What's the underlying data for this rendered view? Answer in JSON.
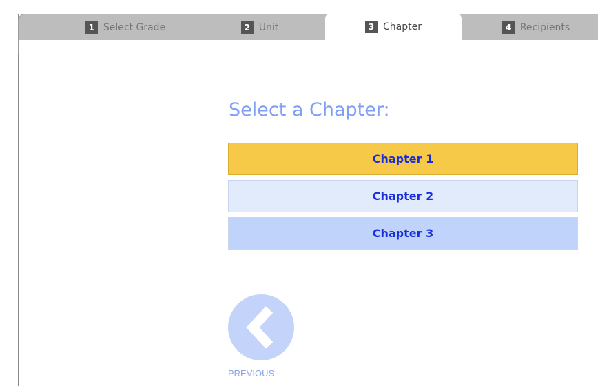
{
  "tabs": [
    {
      "num": "1",
      "label": "Select Grade"
    },
    {
      "num": "2",
      "label": "Unit"
    },
    {
      "num": "3",
      "label": "Chapter"
    },
    {
      "num": "4",
      "label": "Recipients"
    }
  ],
  "active_tab": "3",
  "heading": "Select a Chapter:",
  "chapters": [
    {
      "label": "Chapter 1",
      "state": "selected"
    },
    {
      "label": "Chapter 2",
      "state": "default"
    },
    {
      "label": "Chapter 3",
      "state": "hover"
    }
  ],
  "navigation": {
    "previous_label": "PREVIOUS",
    "previous_icon": "chevron-left-icon"
  },
  "colors": {
    "heading": "#7f9ef5",
    "chapter_text": "#1a2fdc",
    "selected_bg": "#f7c948",
    "default_bg": "#e2ebfc",
    "hover_bg": "#c0d4fb",
    "tab_bar": "#bdbdbd"
  }
}
